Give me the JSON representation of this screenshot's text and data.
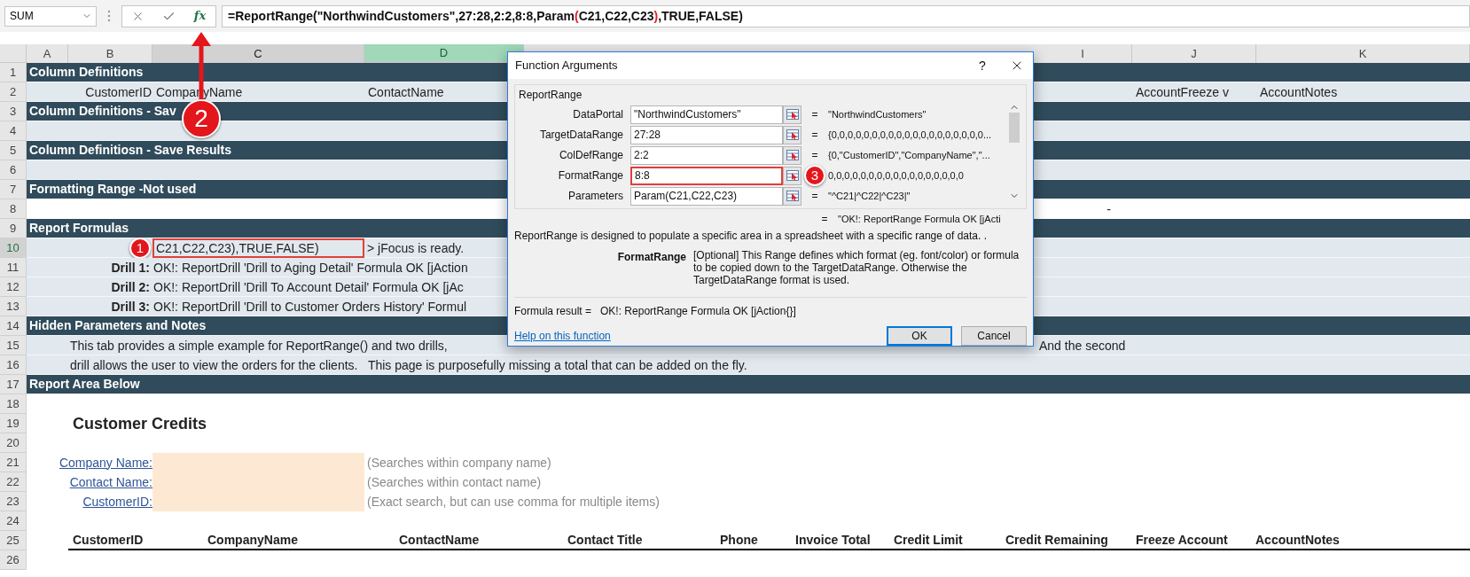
{
  "name_box": "SUM",
  "function_button": "fx",
  "formula": [
    {
      "text": "=ReportRange(\"NorthwindCustomers\",27:28,2:2,8:8,Param",
      "highlight": false
    },
    {
      "text": "(",
      "highlight": true
    },
    {
      "text": "C21,C22,C23",
      "highlight": false
    },
    {
      "text": ")",
      "highlight": true
    },
    {
      "text": ",TRUE,FALSE)",
      "highlight": false
    }
  ],
  "formula_callout": "2",
  "columns": [
    {
      "label": "A",
      "selected": false,
      "in_range": false
    },
    {
      "label": "B",
      "selected": false,
      "in_range": false
    },
    {
      "label": "C",
      "selected": false,
      "in_range": true
    },
    {
      "label": "D",
      "selected": true,
      "in_range": false
    },
    {
      "label": "I",
      "selected": false,
      "in_range": false
    },
    {
      "label": "J",
      "selected": false,
      "in_range": false
    },
    {
      "label": "K",
      "selected": false,
      "in_range": false
    }
  ],
  "rows": [
    {
      "number": "1",
      "selected": false,
      "kind": "banner",
      "text": "Column Definitions"
    },
    {
      "number": "2",
      "selected": false,
      "kind": "fields",
      "cells": [
        "CustomerID",
        "CompanyName",
        "ContactName",
        "AccountFreeze v",
        "AccountNotes"
      ]
    },
    {
      "number": "3",
      "selected": false,
      "kind": "banner",
      "text": "Column Definitions - Sav"
    },
    {
      "number": "4",
      "selected": false,
      "kind": "band"
    },
    {
      "number": "5",
      "selected": false,
      "kind": "banner",
      "text": "Column Definitiosn - Save Results"
    },
    {
      "number": "6",
      "selected": false,
      "kind": "band"
    },
    {
      "number": "7",
      "selected": false,
      "kind": "banner",
      "text": "Formatting Range -Not used"
    },
    {
      "number": "8",
      "selected": false,
      "kind": "dash",
      "text": "-"
    },
    {
      "number": "9",
      "selected": false,
      "kind": "banner",
      "text": "Report Formulas"
    },
    {
      "number": "10",
      "selected": true,
      "kind": "formula",
      "callout": "1",
      "cell": "C21,C22,C23),TRUE,FALSE)",
      "text": "> jFocus is ready."
    },
    {
      "number": "11",
      "selected": false,
      "kind": "drill",
      "label": "Drill 1:",
      "text": "OK!: ReportDrill 'Drill to Aging Detail' Formula OK [jAction"
    },
    {
      "number": "12",
      "selected": false,
      "kind": "drill",
      "label": "Drill 2:",
      "text": "OK!: ReportDrill 'Drill To Account Detail' Formula OK [jAc"
    },
    {
      "number": "13",
      "selected": false,
      "kind": "drill",
      "label": "Drill 3:",
      "text": "OK!: ReportDrill 'Drill to Customer Orders History' Formul"
    },
    {
      "number": "14",
      "selected": false,
      "kind": "banner",
      "text": "Hidden Parameters and Notes"
    },
    {
      "number": "15",
      "selected": false,
      "kind": "note",
      "parts": [
        "This tab provides a simple example for ReportRange() and two drills,",
        "And the second"
      ]
    },
    {
      "number": "16",
      "selected": false,
      "kind": "note",
      "parts": [
        "drill allows the user to view the orders for the clients.   This page is purposefully missing a total that can be added on the fly."
      ]
    },
    {
      "number": "17",
      "selected": false,
      "kind": "banner",
      "text": "Report Area Below"
    },
    {
      "number": "18",
      "selected": false,
      "kind": "blank"
    },
    {
      "number": "19",
      "selected": false,
      "kind": "title",
      "text": "Customer Credits"
    },
    {
      "number": "20",
      "selected": false,
      "kind": "blank"
    },
    {
      "number": "21",
      "selected": false,
      "kind": "search",
      "label": "Company Name:",
      "hint": "(Searches within company name)"
    },
    {
      "number": "22",
      "selected": false,
      "kind": "search",
      "label": "Contact Name:",
      "hint": "(Searches within contact name)"
    },
    {
      "number": "23",
      "selected": false,
      "kind": "search",
      "label": "CustomerID:",
      "hint": "(Exact search, but can use comma for multiple items)"
    },
    {
      "number": "24",
      "selected": false,
      "kind": "blank"
    },
    {
      "number": "25",
      "selected": false,
      "kind": "headings",
      "headings": [
        "CustomerID",
        "CompanyName",
        "ContactName",
        "Contact Title",
        "Phone",
        "Invoice Total",
        "Credit Limit",
        "Credit Remaining",
        "Freeze Account",
        "AccountNotes"
      ]
    },
    {
      "number": "26",
      "selected": false,
      "kind": "blank"
    }
  ],
  "dialog": {
    "title": "Function Arguments",
    "help": "?",
    "function": "ReportRange",
    "args": [
      {
        "label": "DataPortal",
        "value": "\"NorthwindCustomers\"",
        "sign": "=",
        "result": "\"NorthwindCustomers\"",
        "selected": false
      },
      {
        "label": "TargetDataRange",
        "value": "27:28",
        "sign": "=",
        "result": "{0,0,0,0,0,0,0,0,0,0,0,0,0,0,0,0,0,0,0...",
        "selected": false
      },
      {
        "label": "ColDefRange",
        "value": "2:2",
        "sign": "=",
        "result": "{0,\"CustomerID\",\"CompanyName\",\"...",
        "selected": false
      },
      {
        "label": "FormatRange",
        "value": "8:8",
        "callout": "3",
        "result": "0,0,0,0,0,0,0,0,0,0,0,0,0,0,0,0,0",
        "selected": true
      },
      {
        "label": "Parameters",
        "value": "Param(C21,C22,C23)",
        "sign": "=",
        "result": "\"^C21|^C22|^C23|\"",
        "selected": false
      }
    ],
    "preview_sign": "=",
    "preview": "\"OK!: ReportRange Formula OK [jActi",
    "description": "ReportRange is designed to populate a specific area in a spreadsheet with a specific range of data. .",
    "arg_name": "FormatRange",
    "arg_help": "[Optional] This Range defines which format (eg. font/color) or formula to be copied down to the TargetDataRange. Otherwise the TargetDataRange format is used.",
    "result_label": "Formula result =",
    "result_value": "OK!: ReportRange Formula OK [jAction{}]",
    "help_link": "Help on this function",
    "buttons": [
      {
        "label": "OK",
        "default": true
      },
      {
        "label": "Cancel",
        "default": false
      }
    ]
  }
}
